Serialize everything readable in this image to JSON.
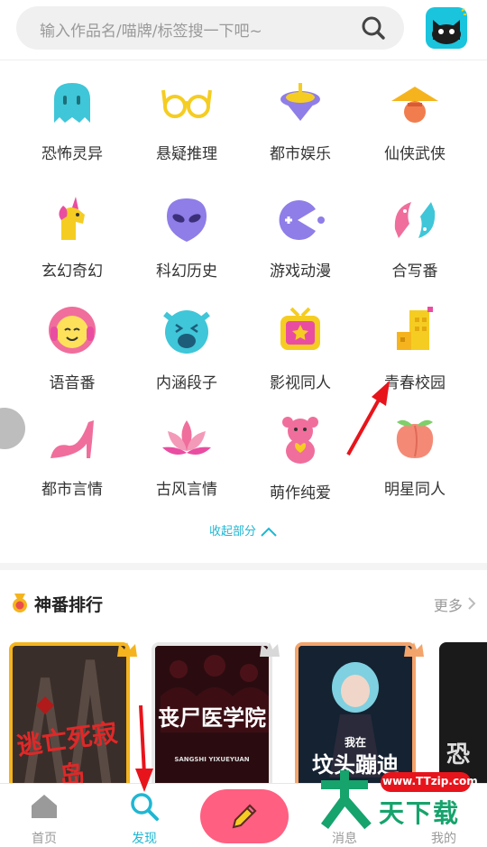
{
  "search": {
    "placeholder": "输入作品名/喵牌/标签搜一下吧~"
  },
  "categories": [
    {
      "label": "恐怖灵异",
      "icon": "ghost-icon"
    },
    {
      "label": "悬疑推理",
      "icon": "glasses-icon"
    },
    {
      "label": "都市娱乐",
      "icon": "spinning-top-icon"
    },
    {
      "label": "仙侠武侠",
      "icon": "straw-hat-icon"
    },
    {
      "label": "玄幻奇幻",
      "icon": "unicorn-icon"
    },
    {
      "label": "科幻历史",
      "icon": "alien-icon"
    },
    {
      "label": "游戏动漫",
      "icon": "pacman-icon"
    },
    {
      "label": "合写番",
      "icon": "fish-icon"
    },
    {
      "label": "语音番",
      "icon": "headphones-face-icon"
    },
    {
      "label": "内涵段子",
      "icon": "laughing-face-icon"
    },
    {
      "label": "影视同人",
      "icon": "tv-icon"
    },
    {
      "label": "青春校园",
      "icon": "school-building-icon"
    },
    {
      "label": "都市言情",
      "icon": "high-heel-icon"
    },
    {
      "label": "古风言情",
      "icon": "lotus-icon"
    },
    {
      "label": "萌作纯爱",
      "icon": "teddy-bear-icon"
    },
    {
      "label": "明星同人",
      "icon": "peach-icon"
    }
  ],
  "collapse_label": "收起部分",
  "ranking": {
    "title": "神番排行",
    "more_label": "更多",
    "books": [
      {
        "title": "逃亡死寂岛"
      },
      {
        "title": "丧尸医学院",
        "subtitle": "SANGSHI YIXUEYUAN"
      },
      {
        "title": "坟头蹦迪",
        "prefix": "我在"
      },
      {
        "title": "恐"
      }
    ]
  },
  "tabbar": {
    "tabs": [
      {
        "label": "首页"
      },
      {
        "label": "发现"
      },
      {
        "label": "消息"
      },
      {
        "label": "我的"
      }
    ]
  },
  "watermark": {
    "url": "www.TTzip.com",
    "text": "天下载"
  },
  "colors": {
    "accent": "#1fb7d3",
    "fab": "#ff5f81",
    "arrow": "#e8141b"
  }
}
